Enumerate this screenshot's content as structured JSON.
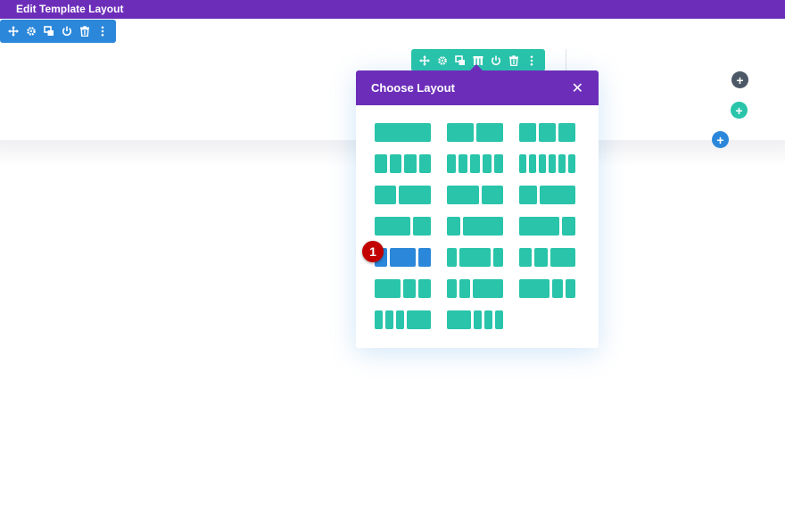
{
  "topbar": {
    "title": "Edit Template Layout"
  },
  "section_toolbar": {
    "icons": [
      "move-icon",
      "gear-icon",
      "duplicate-icon",
      "power-icon",
      "trash-icon",
      "more-icon"
    ]
  },
  "row_toolbar": {
    "icons": [
      "move-icon",
      "gear-icon",
      "duplicate-icon",
      "columns-icon",
      "power-icon",
      "trash-icon",
      "more-icon"
    ]
  },
  "modal": {
    "title": "Choose Layout",
    "close_label": "✕",
    "layouts": [
      {
        "id": "1",
        "cols": [
          1
        ]
      },
      {
        "id": "1_2,1_2",
        "cols": [
          1,
          1
        ]
      },
      {
        "id": "1_3,1_3,1_3",
        "cols": [
          1,
          1,
          1
        ]
      },
      {
        "id": "1_4x4",
        "cols": [
          1,
          1,
          1,
          1
        ]
      },
      {
        "id": "1_5x5",
        "cols": [
          1,
          1,
          1,
          1,
          1
        ]
      },
      {
        "id": "1_6x6",
        "cols": [
          1,
          1,
          1,
          1,
          1,
          1
        ]
      },
      {
        "id": "2_5,3_5",
        "cols": [
          2,
          3
        ]
      },
      {
        "id": "3_5,2_5",
        "cols": [
          3,
          2
        ]
      },
      {
        "id": "1_3,2_3",
        "cols": [
          1,
          2
        ]
      },
      {
        "id": "2_3,1_3",
        "cols": [
          2,
          1
        ]
      },
      {
        "id": "1_4,3_4",
        "cols": [
          1,
          3
        ]
      },
      {
        "id": "3_4,1_4",
        "cols": [
          3,
          1
        ]
      },
      {
        "id": "1_4,1_2,1_4",
        "cols": [
          1,
          2,
          1
        ]
      },
      {
        "id": "1_5,3_5,1_5",
        "cols": [
          1,
          3,
          1
        ]
      },
      {
        "id": "1_4,1_4,1_2",
        "cols": [
          1,
          1,
          2
        ]
      },
      {
        "id": "1_2,1_4,1_4",
        "cols": [
          2,
          1,
          1
        ]
      },
      {
        "id": "1_5,1_5,3_5",
        "cols": [
          1,
          1,
          3
        ]
      },
      {
        "id": "3_5,1_5,1_5",
        "cols": [
          3,
          1,
          1
        ]
      },
      {
        "id": "1_6,1_6,1_6,1_2",
        "cols": [
          1,
          1,
          1,
          3
        ]
      },
      {
        "id": "1_2,1_6,1_6,1_6",
        "cols": [
          3,
          1,
          1,
          1
        ]
      }
    ],
    "selected_index": 12
  },
  "annotation": {
    "badge": "1"
  },
  "colors": {
    "purple": "#6c2eb9",
    "teal": "#29c4a9",
    "blue": "#2b87da",
    "dark": "#4c5866",
    "badge_red": "#c20000"
  }
}
